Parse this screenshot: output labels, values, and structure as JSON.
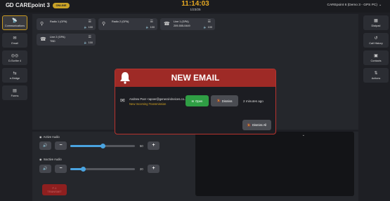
{
  "header": {
    "app_name": "CAREpoint 3",
    "status": "ONLINE",
    "clock": "11:14:03",
    "date": "1/23/25",
    "account": "CAREpoint 6 (Demo 3 - GPS PC)"
  },
  "left_nav": [
    {
      "label": "Communications",
      "icon": "radio-tower-icon",
      "active": true
    },
    {
      "label": "Email",
      "icon": "email-icon"
    },
    {
      "label": "D-Scribe 4",
      "icon": "voicemail-icon"
    },
    {
      "label": "e-Bridge",
      "icon": "bridge-icon"
    },
    {
      "label": "Forms",
      "icon": "form-icon"
    }
  ],
  "right_nav": [
    {
      "label": "Dialpad",
      "icon": "dialpad-icon"
    },
    {
      "label": "Call History",
      "icon": "history-icon"
    },
    {
      "label": "Contacts",
      "icon": "contacts-icon"
    },
    {
      "label": "Actions",
      "icon": "actions-icon"
    }
  ],
  "tiles": [
    {
      "name": "Radio 1 (GPA)",
      "sub": "",
      "volume": "100",
      "icon": "antenna-icon"
    },
    {
      "name": "Radio 2 (GPA)",
      "sub": "",
      "volume": "100",
      "icon": "antenna-icon"
    },
    {
      "name": "Line 1 (GPA)",
      "sub": "209-555-0449",
      "volume": "100",
      "icon": "phone-icon"
    },
    {
      "name": "Line 2 (GPA)",
      "sub": "TBD",
      "volume": "100",
      "icon": "phone-icon"
    }
  ],
  "audio": {
    "active_label": "Active Audio",
    "active_value": "50",
    "active_level": 0.5,
    "inactive_label": "Inactive Audio",
    "inactive_value": "20",
    "inactive_level": 0.2,
    "transmit_line1": "F-1",
    "transmit_line2": "TRANSMIT"
  },
  "modal": {
    "title": "NEW EMAIL",
    "sender": "Andrew Poer <apoer@general-devices.co...",
    "subtitle": "New Incoming Transmission",
    "open_label": "Open",
    "dismiss_label": "Dismiss",
    "time_ago": "2 minutes ago",
    "dismiss_all_label": "Dismiss All"
  }
}
